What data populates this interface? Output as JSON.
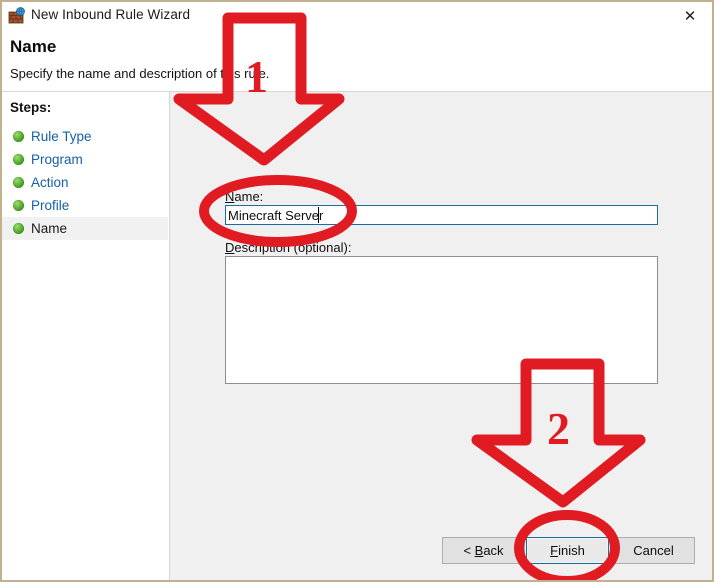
{
  "window": {
    "title": "New Inbound Rule Wizard",
    "icon": "firewall-shield-icon",
    "close_label": "✕",
    "border_color": "#c3b091"
  },
  "header": {
    "title": "Name",
    "subtitle": "Specify the name and description of this rule."
  },
  "sidebar": {
    "heading": "Steps:",
    "items": [
      {
        "label": "Rule Type",
        "current": false
      },
      {
        "label": "Program",
        "current": false
      },
      {
        "label": "Action",
        "current": false
      },
      {
        "label": "Profile",
        "current": false
      },
      {
        "label": "Name",
        "current": true
      }
    ]
  },
  "form": {
    "name_label": "Name:",
    "name_accesskey": "N",
    "name_value": "Minecraft Server",
    "name_placeholder": "",
    "description_label": "Description (optional):",
    "description_accesskey": "D",
    "description_value": "",
    "description_placeholder": ""
  },
  "footer": {
    "back_label": "< Back",
    "back_accesskey": "B",
    "finish_label": "Finish",
    "finish_accesskey": "F",
    "cancel_label": "Cancel"
  },
  "annotations": {
    "color": "#e01b22",
    "arrow_one_number": "1",
    "arrow_two_number": "2",
    "ellipse_name_field": "highlights the Name text box",
    "ellipse_finish_button": "highlights the Finish button"
  }
}
